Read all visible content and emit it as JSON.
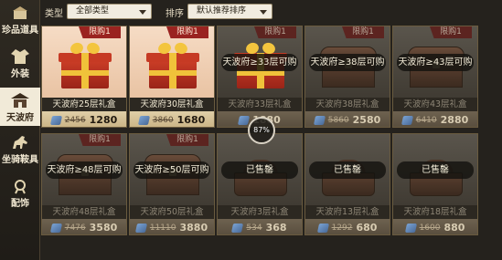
{
  "sidebar": {
    "items": [
      {
        "label": "珍品道具",
        "icon": "treasure-icon",
        "active": false
      },
      {
        "label": "外装",
        "icon": "clothing-icon",
        "active": false
      },
      {
        "label": "天波府",
        "icon": "mansion-icon",
        "active": true
      },
      {
        "label": "坐骑鞍具",
        "icon": "horse-icon",
        "active": false
      },
      {
        "label": "配饰",
        "icon": "accessory-icon",
        "active": false
      }
    ]
  },
  "filters": {
    "type_label": "类型",
    "type_value": "全部类型",
    "sort_label": "排序",
    "sort_value": "默认推荐排序"
  },
  "cards": [
    {
      "name": "天波府25层礼盒",
      "ribbon": "限购1",
      "overlay": "",
      "old_price": "2456",
      "price": "1280",
      "art": "gift",
      "dim": false
    },
    {
      "name": "天波府30层礼盒",
      "ribbon": "限购1",
      "overlay": "",
      "old_price": "3860",
      "price": "1680",
      "art": "gift",
      "dim": false
    },
    {
      "name": "天波府33层礼盒",
      "ribbon": "限购1",
      "overlay": "天波府≥33层可购",
      "old_price": "",
      "price": "1880",
      "art": "gift",
      "dim": true
    },
    {
      "name": "天波府38层礼盒",
      "ribbon": "限购1",
      "overlay": "天波府≥38层可购",
      "old_price": "5860",
      "price": "2580",
      "art": "chest",
      "dim": true
    },
    {
      "name": "天波府43层礼盒",
      "ribbon": "限购1",
      "overlay": "天波府≥43层可购",
      "old_price": "6410",
      "price": "2880",
      "art": "chest",
      "dim": true
    },
    {
      "name": "天波府48层礼盒",
      "ribbon": "限购1",
      "overlay": "天波府≥48层可购",
      "old_price": "7476",
      "price": "3580",
      "art": "chest",
      "dim": true
    },
    {
      "name": "天波府50层礼盒",
      "ribbon": "限购1",
      "overlay": "天波府≥50层可购",
      "old_price": "11110",
      "price": "3880",
      "art": "chest",
      "dim": true
    },
    {
      "name": "天波府3层礼盒",
      "ribbon": "",
      "overlay": "已售罄",
      "old_price": "534",
      "price": "368",
      "art": "basket",
      "dim": true
    },
    {
      "name": "天波府13层礼盒",
      "ribbon": "",
      "overlay": "已售罄",
      "old_price": "1292",
      "price": "680",
      "art": "basket",
      "dim": true
    },
    {
      "name": "天波府18层礼盒",
      "ribbon": "",
      "overlay": "已售罄",
      "old_price": "1600",
      "price": "880",
      "art": "basket",
      "dim": true
    }
  ],
  "loading": {
    "percent_label": "87%"
  },
  "colors": {
    "accent_red": "#9a2320",
    "sidebar_active": "#f1ead8",
    "price_bar": "#d9c59b"
  }
}
